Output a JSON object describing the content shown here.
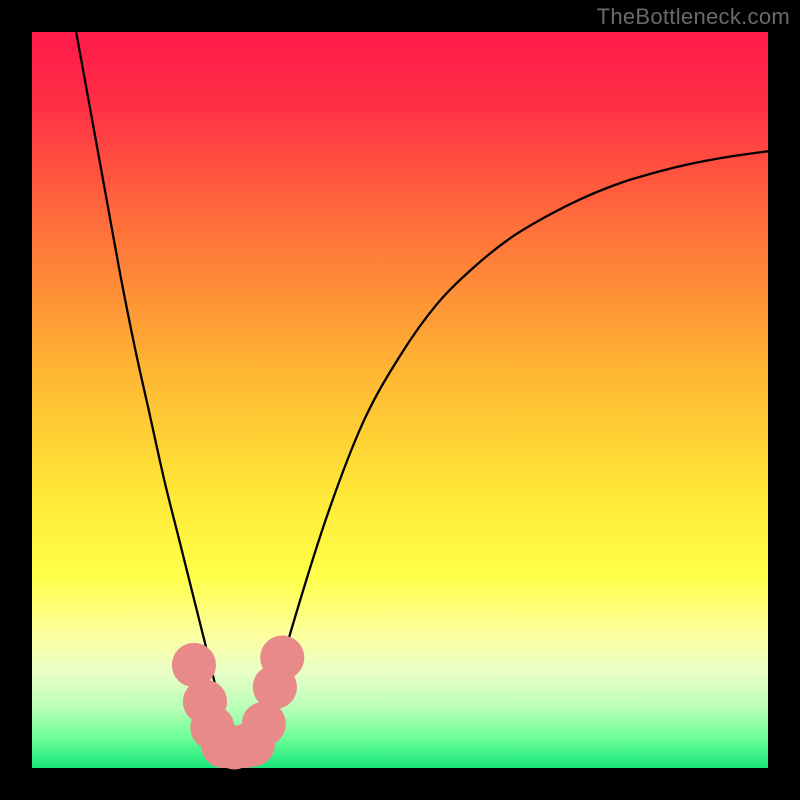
{
  "watermark": "TheBottleneck.com",
  "chart_data": {
    "type": "line",
    "title": "",
    "xlabel": "",
    "ylabel": "",
    "xlim": [
      0,
      100
    ],
    "ylim": [
      0,
      100
    ],
    "grid": false,
    "legend": false,
    "background_gradient": [
      {
        "pos": 0.0,
        "color": "#ff1a4a"
      },
      {
        "pos": 0.1,
        "color": "#ff2f45"
      },
      {
        "pos": 0.25,
        "color": "#ff6a3b"
      },
      {
        "pos": 0.45,
        "color": "#ffb233"
      },
      {
        "pos": 0.62,
        "color": "#ffe637"
      },
      {
        "pos": 0.74,
        "color": "#ffff4a"
      },
      {
        "pos": 0.82,
        "color": "#fcffa0"
      },
      {
        "pos": 0.87,
        "color": "#e9ffc8"
      },
      {
        "pos": 0.92,
        "color": "#b7ffb7"
      },
      {
        "pos": 0.96,
        "color": "#6aff96"
      },
      {
        "pos": 1.0,
        "color": "#16e57a"
      }
    ],
    "series": [
      {
        "name": "bottleneck-curve",
        "color": "#000000",
        "x": [
          6,
          8,
          10,
          12,
          14,
          16,
          18,
          20,
          22,
          24,
          25.5,
          27,
          28.5,
          30,
          32,
          35,
          40,
          45,
          50,
          55,
          60,
          65,
          70,
          75,
          80,
          85,
          90,
          95,
          100
        ],
        "y": [
          100,
          89,
          78,
          67,
          57,
          48,
          39,
          31,
          23,
          15,
          9,
          5,
          3,
          3,
          7,
          18,
          34,
          47,
          56,
          63,
          68,
          72,
          75,
          77.5,
          79.5,
          81,
          82.2,
          83.1,
          83.8
        ]
      }
    ],
    "markers": {
      "name": "valley-markers",
      "color": "#e98a8a",
      "radius": 3.0,
      "points": [
        {
          "x": 22.0,
          "y": 14.0
        },
        {
          "x": 23.5,
          "y": 9.0
        },
        {
          "x": 24.5,
          "y": 5.5
        },
        {
          "x": 26.0,
          "y": 3.0
        },
        {
          "x": 27.5,
          "y": 2.8
        },
        {
          "x": 29.0,
          "y": 3.0
        },
        {
          "x": 30.0,
          "y": 3.2
        },
        {
          "x": 31.5,
          "y": 6.0
        },
        {
          "x": 33.0,
          "y": 11.0
        },
        {
          "x": 34.0,
          "y": 15.0
        }
      ]
    }
  }
}
